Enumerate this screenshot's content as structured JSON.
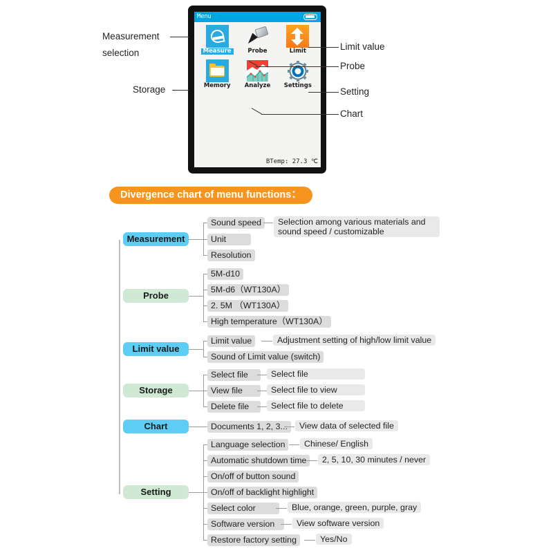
{
  "device": {
    "status_title": "Menu",
    "battery_icon": "battery-icon",
    "icons": [
      {
        "label": "Measure",
        "icon": "measure-gauge-icon",
        "selected": true
      },
      {
        "label": "Probe",
        "icon": "probe-icon",
        "selected": false
      },
      {
        "label": "Limit",
        "icon": "limit-arrows-icon",
        "selected": false
      },
      {
        "label": "Memory",
        "icon": "folder-icon",
        "selected": false
      },
      {
        "label": "Analyze",
        "icon": "chart-icon",
        "selected": false
      },
      {
        "label": "Settings",
        "icon": "gear-icon",
        "selected": false
      }
    ],
    "btemp": "BTemp: 27.3 ℃"
  },
  "callouts": {
    "left": [
      {
        "line1": "Measurement",
        "line2": "selection"
      },
      {
        "line1": "Storage",
        "line2": ""
      }
    ],
    "right": [
      "Limit value",
      "Probe",
      "Setting",
      "Chart"
    ]
  },
  "banner": {
    "title": "Divergence chart of menu functions："
  },
  "tree": {
    "sections": [
      {
        "root": "Measurement",
        "color": "blue",
        "leaves": [
          {
            "label": "Sound speed",
            "desc": "Selection among various materials and sound speed / customizable"
          },
          {
            "label": "Unit",
            "desc": ""
          },
          {
            "label": "Resolution",
            "desc": ""
          }
        ]
      },
      {
        "root": "Probe",
        "color": "green",
        "leaves": [
          {
            "label": "5M-d10",
            "desc": ""
          },
          {
            "label": "5M-d6（WT130A）",
            "desc": ""
          },
          {
            "label": "2. 5M （WT130A）",
            "desc": ""
          },
          {
            "label": "High temperature（WT130A）",
            "desc": ""
          }
        ]
      },
      {
        "root": "Limit value",
        "color": "blue",
        "leaves": [
          {
            "label": "Limit value",
            "desc": "Adjustment setting of high/low limit value"
          },
          {
            "label": "Sound of Limit value (switch)",
            "desc": ""
          }
        ]
      },
      {
        "root": "Storage",
        "color": "green",
        "leaves": [
          {
            "label": "Select file",
            "desc": "Select file"
          },
          {
            "label": "View file",
            "desc": "Select file to view"
          },
          {
            "label": "Delete file",
            "desc": "Select file to delete"
          }
        ]
      },
      {
        "root": "Chart",
        "color": "blue",
        "leaves": [
          {
            "label": "Documents 1, 2, 3...",
            "desc": "View data of selected file"
          }
        ]
      },
      {
        "root": "Setting",
        "color": "green",
        "leaves": [
          {
            "label": "Language selection",
            "desc": "Chinese/ English"
          },
          {
            "label": "Automatic shutdown time",
            "desc": "2, 5, 10, 30 minutes / never"
          },
          {
            "label": "On/off of button sound",
            "desc": ""
          },
          {
            "label": "On/off of backlight highlight",
            "desc": ""
          },
          {
            "label": "Select color",
            "desc": "Blue, orange, green, purple, gray"
          },
          {
            "label": "Software version",
            "desc": "View software version"
          },
          {
            "label": "Restore factory setting",
            "desc": "Yes/No"
          }
        ]
      }
    ]
  },
  "colors": {
    "banner": "#f7941d",
    "status_bar": "#00a5e3",
    "root_blue": "#5ecdf3",
    "root_green": "#cfe9d5",
    "leaf_bg": "#dcdcdc",
    "desc_bg": "#e9e9e9"
  }
}
